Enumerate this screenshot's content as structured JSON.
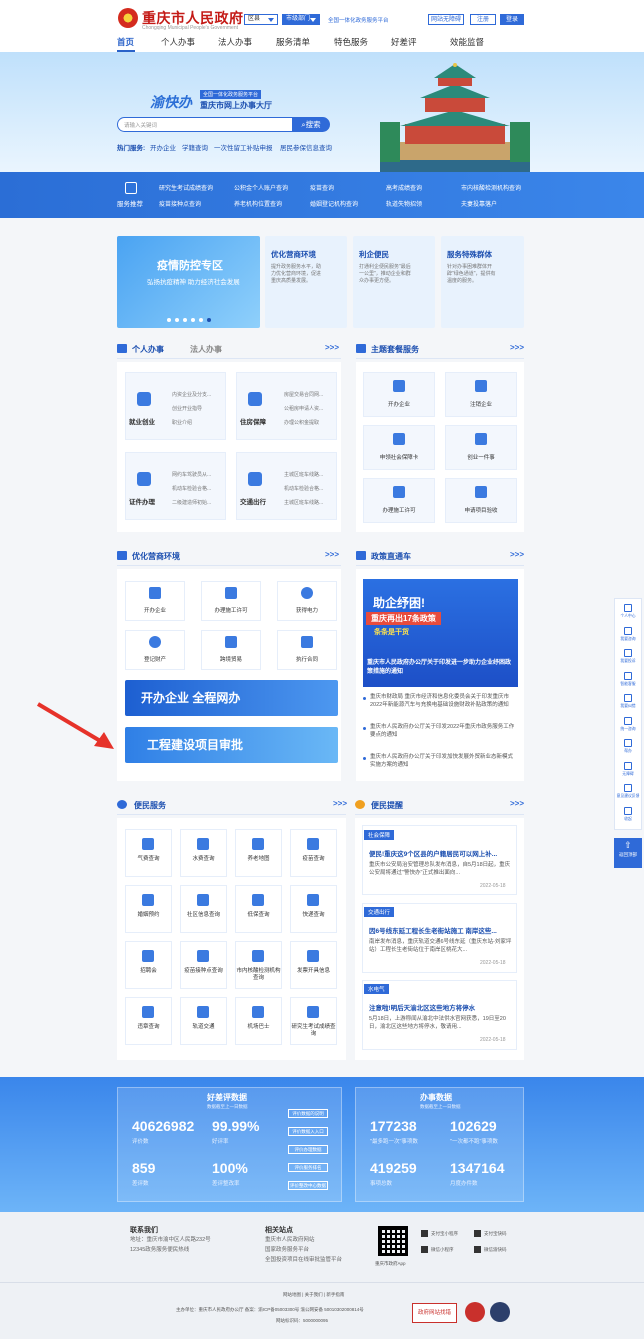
{
  "header": {
    "title": "重庆市人民政府",
    "subtitle": "Chongqing Municipal People's Government",
    "district_select": "区县",
    "dept_select": "市级部门",
    "slogan": "全国一体化政务服务平台",
    "barrier_free": "网站无障碍",
    "register": "注册",
    "login": "登录"
  },
  "nav": [
    "首页",
    "个人办事",
    "法人办事",
    "服务清单",
    "特色服务",
    "好差评",
    "效能监督"
  ],
  "banner": {
    "brand": "渝快办",
    "tag": "全国一体化政务服务平台",
    "hall": "重庆市网上办事大厅",
    "search_placeholder": "请输入关键词",
    "search_btn": "搜索",
    "hot_label": "热门服务:",
    "hot_links": [
      "开办企业",
      "学籍查询",
      "一次性留工补贴申报",
      "居民参保信息查询"
    ]
  },
  "recommend": {
    "label": "服务推荐",
    "row1": [
      "研究生考试成绩查询",
      "公积金个人账户查询",
      "疫苗查询",
      "高考成绩查询",
      "市内核酸检测机构查询"
    ],
    "row2": [
      "疫苗接种点查询",
      "养老机构位置查询",
      "婚姻登记机构查询",
      "轨道失物招领",
      "夫妻投靠落户"
    ]
  },
  "top_cards": {
    "covid_title": "疫情防控专区",
    "covid_sub": "弘扬抗疫精神  助力经济社会发展",
    "cards": [
      {
        "title": "优化营商环境",
        "desc": "提升政务服务水平，助力优化营商环境，促进重庆高质量发展。"
      },
      {
        "title": "利企便民",
        "desc": "打通利企便民服务\"最后一公里\"，推动企业和群众办事更方便。"
      },
      {
        "title": "服务特殊群体",
        "desc": "针对办事困难群体开辟\"绿色通道\"，提供有温度的服务。"
      }
    ]
  },
  "personal": {
    "tab_active": "个人办事",
    "tab_other": "法人办事",
    "more": ">>>",
    "items": [
      {
        "name": "就业创业",
        "subs": [
          "内资企业及分支...",
          "创业开业指导",
          "职业介绍"
        ]
      },
      {
        "name": "住房保障",
        "subs": [
          "房屋交易合同网...",
          "公租房申请人资...",
          "办理公积金提取"
        ]
      },
      {
        "name": "证件办理",
        "subs": [
          "网约车驾驶员从...",
          "机动车检验合格...",
          "二级建造师初始..."
        ]
      },
      {
        "name": "交通出行",
        "subs": [
          "主城区班车线路...",
          "机动车检验合格...",
          "主城区班车线路..."
        ]
      }
    ]
  },
  "theme": {
    "title": "主题套餐服务",
    "more": ">>>",
    "items": [
      "开办企业",
      "注销企业",
      "申领社会保障卡",
      "创业一件事",
      "办理施工许可",
      "申请项目验收"
    ]
  },
  "business": {
    "title": "优化营商环境",
    "more": ">>>",
    "items": [
      "开办企业",
      "办理施工许可",
      "获得电力",
      "登记财产",
      "跨境贸易",
      "执行合同"
    ],
    "banner1": "开办企业 全程网办",
    "banner2": "工程建设项目审批"
  },
  "policy": {
    "title": "政策直通车",
    "more": ">>>",
    "img_line1": "助企纾困!",
    "img_line2": "重庆再出17条政策",
    "img_line3": "条条是干货",
    "img_caption": "重庆市人民政府办公厅关于印发进一步助力企业纾困政策措施的通知",
    "news": [
      "重庆市财政局 重庆市经济和信息化委员会关于印发重庆市2022年新能源汽车与充换电基础设施财政补贴政策的通知",
      "重庆市人民政府办公厅关于印发2022年重庆市政务服务工作要点的通知",
      "重庆市人民政府办公厅关于印发加快发展外贸新业态新模式实施方案的通知"
    ]
  },
  "convenience": {
    "title": "便民服务",
    "more": ">>>",
    "items": [
      "气费查询",
      "水费查询",
      "养老地图",
      "疫苗查询",
      "婚姻预约",
      "社区信息查询",
      "低保查询",
      "快递查询",
      "招聘会",
      "疫苗接种点查询",
      "市内核酸检测机构查询",
      "发票开具信息",
      "违章查询",
      "轨道交通",
      "机场巴士",
      "研究生考试成绩查询"
    ]
  },
  "tips": {
    "title": "便民提醒",
    "more": ">>>",
    "items": [
      {
        "tag": "社会保障",
        "title": "便民!重庆这9个区县的户籍居民可以网上补...",
        "body": "重庆市公安局治安管理总队发布消息，自5月18日起，重庆公安局将通过\"警快办\"正式推出面向...",
        "date": "2022-05-18"
      },
      {
        "tag": "交通出行",
        "title": "因6号线东延工程长生老街站施工 南岸这些...",
        "body": "南岸发布消息，重庆轨道交通6号线东延（重庆东站-刘家坪站）工程长生老街站位于南岸区桃花大...",
        "date": "2022-05-18"
      },
      {
        "tag": "水电气",
        "title": "注意啦!明后天渝北区这些地方将停水",
        "body": "5月18日，上游称闻从渝北中法供水官网获悉，19日至20日，渝北区这些地方将停水，敬请用...",
        "date": "2022-05-18"
      }
    ]
  },
  "stats": {
    "left_title": "好差评数据",
    "left_cap": "数据截至上一日数据",
    "left": [
      {
        "num": "40626982",
        "lbl": "评价数"
      },
      {
        "num": "99.99%",
        "lbl": "好评率"
      },
      {
        "num": "859",
        "lbl": "差评数"
      },
      {
        "num": "100%",
        "lbl": "差评整改率"
      }
    ],
    "left_btns": [
      "评价数据的说明",
      "评价数据入入口",
      "评价办理数据",
      "评价服务排名",
      "评价整改中心数据"
    ],
    "right_title": "办事数据",
    "right_cap": "数据截至上一日数据",
    "right": [
      {
        "num": "177238",
        "lbl": "\"最多跑一次\"事项数"
      },
      {
        "num": "102629",
        "lbl": "\"一次都不跑\"事项数"
      },
      {
        "num": "419259",
        "lbl": "事项总数"
      },
      {
        "num": "1347164",
        "lbl": "月度办件数"
      }
    ]
  },
  "footer": {
    "contact_h": "联系我们",
    "contact": [
      "地址：重庆市渝中区人民路232号",
      "12345政务服务便民热线"
    ],
    "sites_h": "相关站点",
    "sites": [
      "重庆市人民政府网站",
      "国家政务服务平台",
      "全国投资项目在线审批监管平台"
    ],
    "app_label": "重庆市政府App",
    "minis": [
      "支付宝小程序",
      "支付宝快码",
      "微信小程序",
      "微信渝快码"
    ],
    "links": "网站地图  |  关于我们  |  新手指南",
    "org": "主办单位：重庆市人民政府办公厅 备案：渝ICP备05003300号 渝公网安备 50010302000814号",
    "code": "网站标识码：5000000095",
    "find_error": "政府网站找错"
  },
  "side": {
    "items": [
      "个人中心",
      "我要咨询",
      "我要投诉",
      "智能客服",
      "我要纠错",
      "统一咨询",
      "帮办",
      "无障碍",
      "意见建议反馈",
      "收起"
    ],
    "top": "返回顶部"
  }
}
